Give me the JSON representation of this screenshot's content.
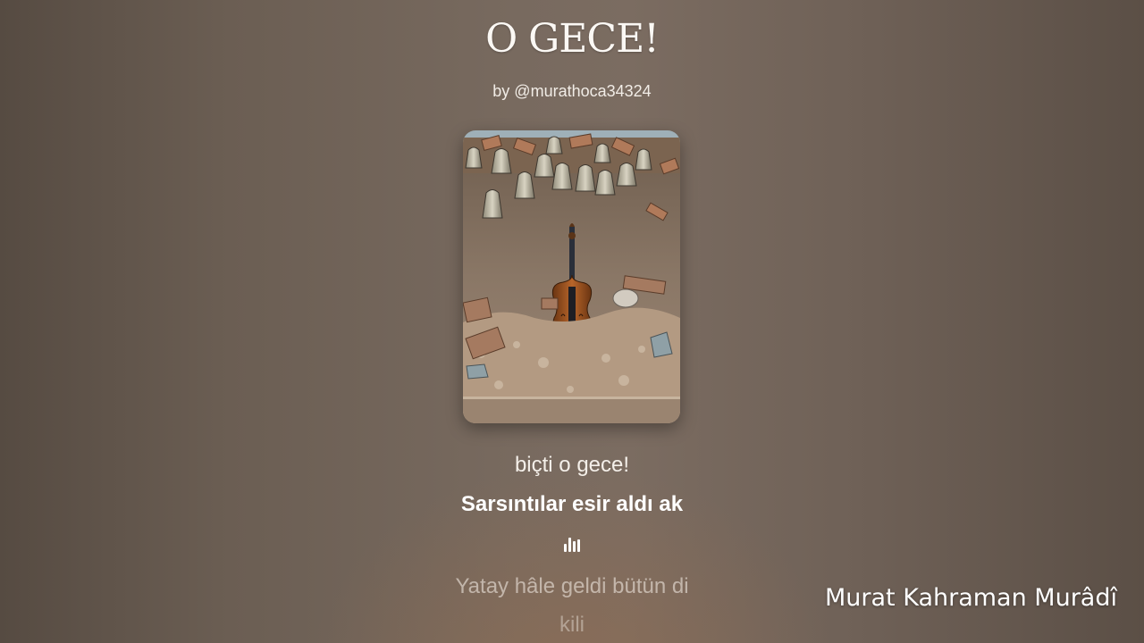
{
  "song": {
    "title": "O GECE!",
    "byline": "by @murathoca34324"
  },
  "cover": {
    "subject": "violin amid rubble and fallen bells"
  },
  "lyrics": {
    "previous": "biçti o gece!",
    "current": "Sarsıntılar esir aldı ak",
    "indicator_icon": "audio-bars-icon",
    "next": "Yatay hâle geldi bütün di",
    "next2": "kili"
  },
  "watermark": "Murat Kahraman Murâdî",
  "colors": {
    "background": "#6f6157",
    "text": "#ffffff"
  }
}
